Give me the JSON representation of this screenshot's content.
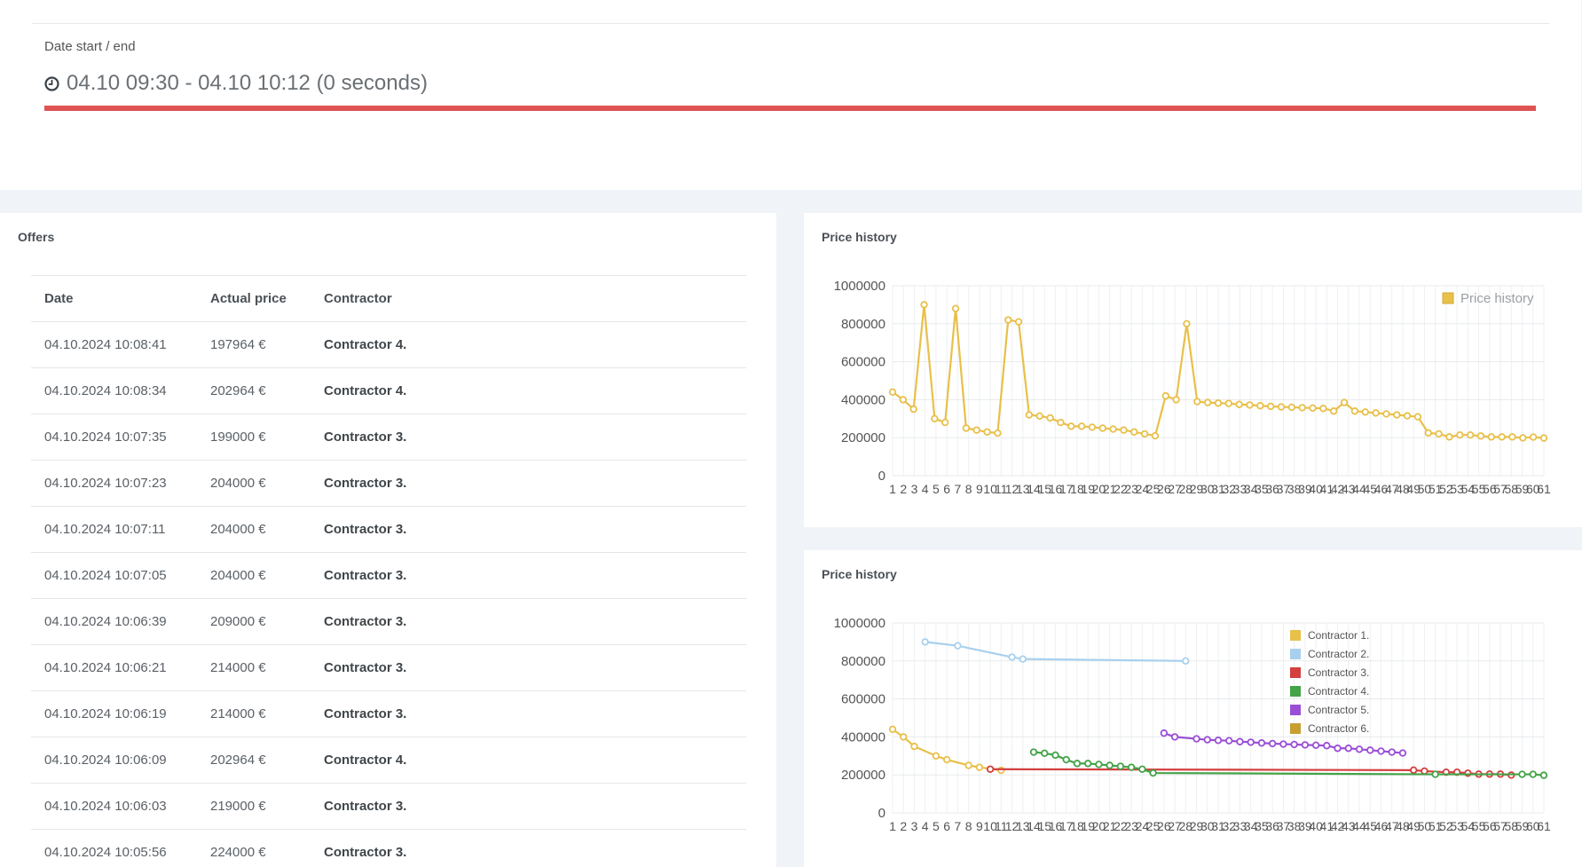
{
  "auction": {
    "date_label": "Date start / end",
    "date_value": "04.10 09:30 - 04.10 10:12 (0 seconds)",
    "progress": 1.0
  },
  "offers": {
    "title": "Offers",
    "columns": [
      "Date",
      "Actual price",
      "Contractor"
    ],
    "rows": [
      {
        "date": "04.10.2024 10:08:41",
        "price": "197964 €",
        "contractor": "Contractor  4."
      },
      {
        "date": "04.10.2024 10:08:34",
        "price": "202964 €",
        "contractor": "Contractor  4."
      },
      {
        "date": "04.10.2024 10:07:35",
        "price": "199000 €",
        "contractor": "Contractor  3."
      },
      {
        "date": "04.10.2024 10:07:23",
        "price": "204000 €",
        "contractor": "Contractor  3."
      },
      {
        "date": "04.10.2024 10:07:11",
        "price": "204000 €",
        "contractor": "Contractor  3."
      },
      {
        "date": "04.10.2024 10:07:05",
        "price": "204000 €",
        "contractor": "Contractor  3."
      },
      {
        "date": "04.10.2024 10:06:39",
        "price": "209000 €",
        "contractor": "Contractor  3."
      },
      {
        "date": "04.10.2024 10:06:21",
        "price": "214000 €",
        "contractor": "Contractor  3."
      },
      {
        "date": "04.10.2024 10:06:19",
        "price": "214000 €",
        "contractor": "Contractor  3."
      },
      {
        "date": "04.10.2024 10:06:09",
        "price": "202964 €",
        "contractor": "Contractor  4."
      },
      {
        "date": "04.10.2024 10:06:03",
        "price": "219000 €",
        "contractor": "Contractor  3."
      },
      {
        "date": "04.10.2024 10:05:56",
        "price": "224000 €",
        "contractor": "Contractor  3."
      }
    ]
  },
  "chart_data": [
    {
      "type": "line",
      "title": "Price history",
      "ylim": [
        0,
        1000000
      ],
      "yticks": [
        "0",
        "200000",
        "400000",
        "600000",
        "800000",
        "1000000"
      ],
      "x": [
        1,
        2,
        3,
        4,
        5,
        6,
        7,
        8,
        9,
        10,
        11,
        12,
        13,
        14,
        15,
        16,
        17,
        18,
        19,
        20,
        21,
        22,
        23,
        24,
        25,
        26,
        27,
        28,
        29,
        30,
        31,
        32,
        33,
        34,
        35,
        36,
        37,
        38,
        39,
        40,
        41,
        42,
        43,
        44,
        45,
        46,
        47,
        48,
        49,
        50,
        51,
        52,
        53,
        54,
        55,
        56,
        57,
        58,
        59,
        60,
        61
      ],
      "grid": true,
      "legend_position": "top-right",
      "series": [
        {
          "name": "Price history",
          "color": "#e8c04a",
          "values": [
            440000,
            400000,
            350000,
            900000,
            300000,
            280000,
            880000,
            250000,
            240000,
            230000,
            224000,
            820000,
            810000,
            320000,
            314000,
            304000,
            280000,
            260000,
            260000,
            255000,
            250000,
            245000,
            240000,
            230000,
            220000,
            210000,
            420000,
            400000,
            800000,
            390000,
            385000,
            382000,
            380000,
            375000,
            372000,
            368000,
            365000,
            362000,
            360000,
            358000,
            356000,
            354000,
            340000,
            385000,
            340000,
            335000,
            330000,
            325000,
            320000,
            315000,
            310000,
            225000,
            220000,
            204000,
            214000,
            214000,
            209000,
            204000,
            204000,
            204000,
            199000,
            202964,
            197964
          ]
        }
      ]
    },
    {
      "type": "line",
      "title": "Price history",
      "ylim": [
        0,
        1000000
      ],
      "yticks": [
        "0",
        "200000",
        "400000",
        "600000",
        "800000",
        "1000000"
      ],
      "x": [
        1,
        2,
        3,
        4,
        5,
        6,
        7,
        8,
        9,
        10,
        11,
        12,
        13,
        14,
        15,
        16,
        17,
        18,
        19,
        20,
        21,
        22,
        23,
        24,
        25,
        26,
        27,
        28,
        29,
        30,
        31,
        32,
        33,
        34,
        35,
        36,
        37,
        38,
        39,
        40,
        41,
        42,
        43,
        44,
        45,
        46,
        47,
        48,
        49,
        50,
        51,
        52,
        53,
        54,
        55,
        56,
        57,
        58,
        59,
        60,
        61
      ],
      "grid": true,
      "legend_position": "top-right",
      "series": [
        {
          "name": "Contractor 1.",
          "color": "#e8c04a",
          "points": [
            [
              1,
              440000
            ],
            [
              2,
              400000
            ],
            [
              3,
              350000
            ],
            [
              5,
              300000
            ],
            [
              6,
              280000
            ],
            [
              8,
              250000
            ],
            [
              9,
              240000
            ],
            [
              11,
              224000
            ]
          ]
        },
        {
          "name": "Contractor 2.",
          "color": "#a8d0ee",
          "points": [
            [
              4,
              900000
            ],
            [
              7,
              880000
            ],
            [
              12,
              820000
            ],
            [
              13,
              810000
            ],
            [
              28,
              800000
            ]
          ]
        },
        {
          "name": "Contractor 3.",
          "color": "#d43f3f",
          "points": [
            [
              10,
              230000
            ],
            [
              49,
              225000
            ],
            [
              50,
              220000
            ],
            [
              52,
              214000
            ],
            [
              53,
              214000
            ],
            [
              54,
              209000
            ],
            [
              55,
              204000
            ],
            [
              56,
              204000
            ],
            [
              57,
              204000
            ],
            [
              58,
              199000
            ]
          ]
        },
        {
          "name": "Contractor 4.",
          "color": "#44a347",
          "points": [
            [
              14,
              320000
            ],
            [
              15,
              314000
            ],
            [
              16,
              304000
            ],
            [
              17,
              280000
            ],
            [
              18,
              260000
            ],
            [
              19,
              260000
            ],
            [
              20,
              255000
            ],
            [
              21,
              250000
            ],
            [
              22,
              245000
            ],
            [
              23,
              240000
            ],
            [
              24,
              230000
            ],
            [
              25,
              210000
            ],
            [
              51,
              202964
            ],
            [
              59,
              202964
            ],
            [
              60,
              202964
            ],
            [
              61,
              197964
            ]
          ]
        },
        {
          "name": "Contractor 5.",
          "color": "#9a4fd6",
          "points": [
            [
              26,
              420000
            ],
            [
              27,
              400000
            ],
            [
              29,
              390000
            ],
            [
              30,
              385000
            ],
            [
              31,
              382000
            ],
            [
              32,
              380000
            ],
            [
              33,
              375000
            ],
            [
              34,
              372000
            ],
            [
              35,
              368000
            ],
            [
              36,
              365000
            ],
            [
              37,
              362000
            ],
            [
              38,
              360000
            ],
            [
              39,
              358000
            ],
            [
              40,
              356000
            ],
            [
              41,
              354000
            ],
            [
              42,
              340000
            ],
            [
              43,
              340000
            ],
            [
              44,
              335000
            ],
            [
              45,
              330000
            ],
            [
              46,
              325000
            ],
            [
              47,
              320000
            ],
            [
              48,
              315000
            ]
          ]
        },
        {
          "name": "Contractor 6.",
          "color": "#c8a030",
          "points": []
        }
      ]
    }
  ]
}
